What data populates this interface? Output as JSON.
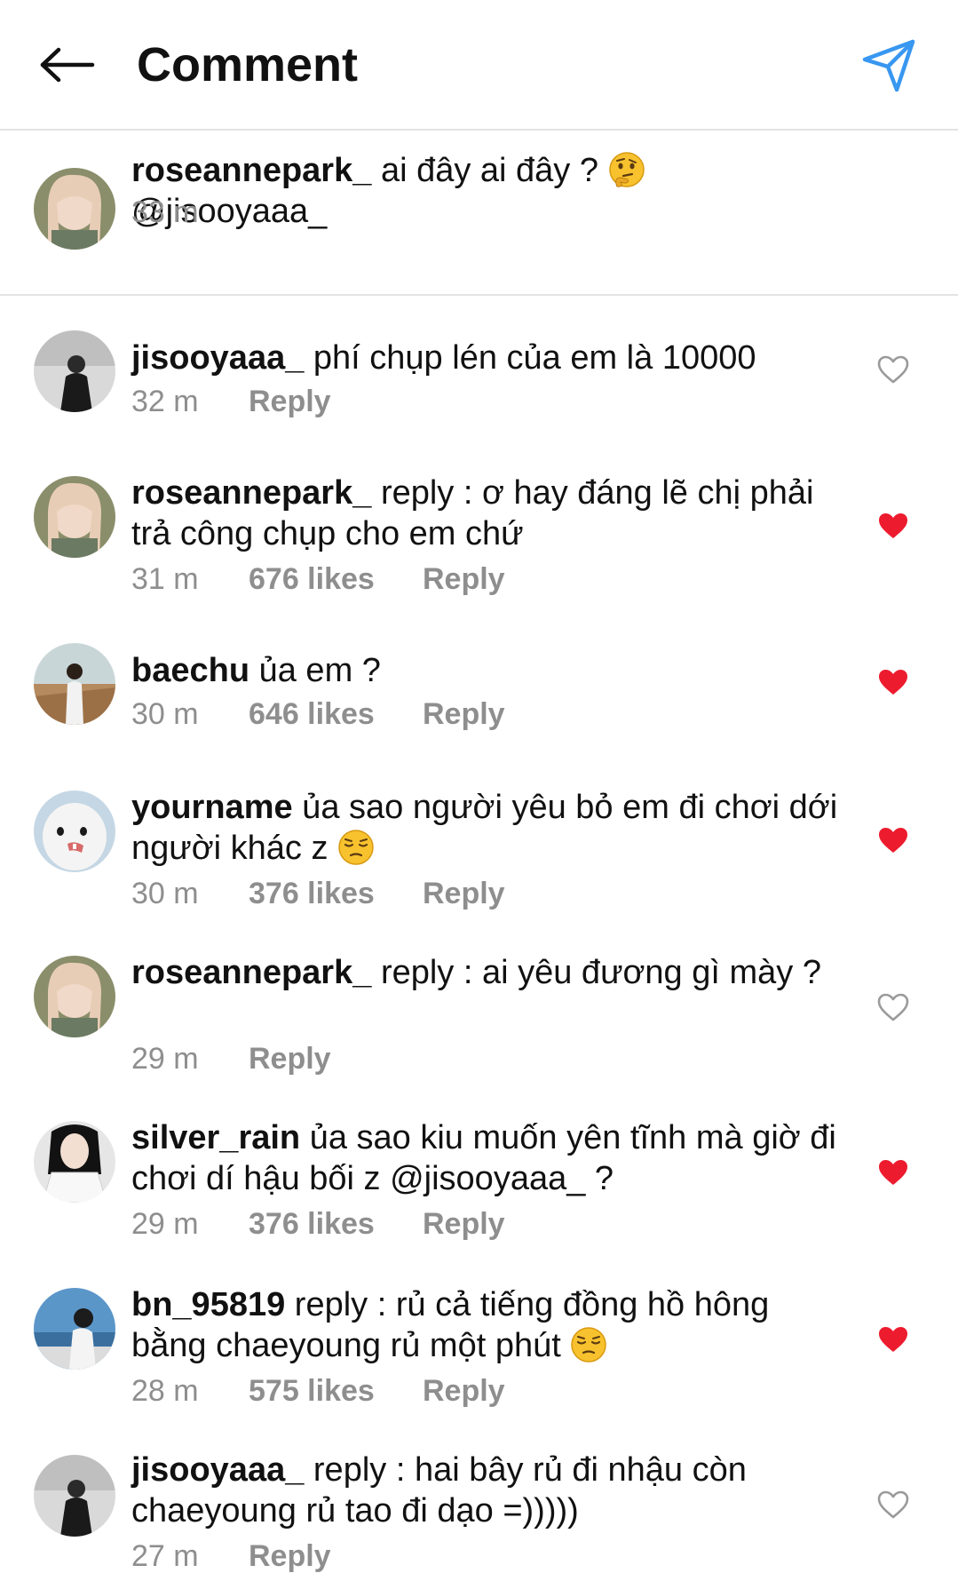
{
  "header": {
    "title": "Comment",
    "back_icon": "arrow-left-icon",
    "send_icon": "paper-plane-icon"
  },
  "caption": {
    "username": "roseannepark_",
    "text_before": "ai đây ai đây ?",
    "emoji": "thinking-face",
    "text_after": "@jisooyaaa_",
    "time": "33 m"
  },
  "colors": {
    "liked_heart": "#ed1b2e",
    "meta_gray": "#8e8e8e",
    "accent_blue": "#3897f0",
    "divider": "#e3e3e3"
  },
  "comments": [
    {
      "username": "jisooyaaa_",
      "text": "phí chụp lén của em là 10000",
      "time": "32 m",
      "likes": "",
      "reply": "Reply",
      "liked": false
    },
    {
      "username": "roseannepark_",
      "text": "reply : ơ hay đáng lẽ chị phải trả công chụp cho em chứ",
      "time": "31 m",
      "likes": "676 likes",
      "reply": "Reply",
      "liked": true
    },
    {
      "username": "baechu",
      "text": "ủa em ?",
      "time": "30 m",
      "likes": "646 likes",
      "reply": "Reply",
      "liked": true
    },
    {
      "username": "yourname",
      "text": "ủa sao người yêu bỏ em đi chơi dới người khác z",
      "emoji": "pensive-face",
      "time": "30 m",
      "likes": "376 likes",
      "reply": "Reply",
      "liked": true
    },
    {
      "username": "roseannepark_",
      "text": "reply : ai yêu đương gì mày ?",
      "time": "29 m",
      "likes": "",
      "reply": "Reply",
      "liked": false
    },
    {
      "username": "silver_rain",
      "text": "ủa sao kiu muốn yên tĩnh mà giờ đi chơi dí hậu bối z @jisooyaaa_ ?",
      "time": "29 m",
      "likes": "376 likes",
      "reply": "Reply",
      "liked": true
    },
    {
      "username": "bn_95819",
      "text": "reply : rủ cả tiếng đồng hồ hông bằng chaeyoung rủ một phút",
      "emoji": "pensive-face",
      "time": "28 m",
      "likes": "575 likes",
      "reply": "Reply",
      "liked": true
    },
    {
      "username": "jisooyaaa_",
      "text": "reply : hai bây rủ đi nhậu còn chaeyoung rủ tao đi dạo =)))))",
      "time": "27 m",
      "likes": "",
      "reply": "Reply",
      "liked": false
    }
  ]
}
